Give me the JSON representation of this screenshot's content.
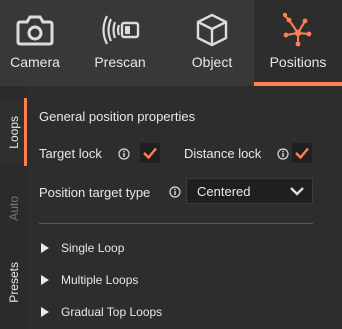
{
  "top_tabs": [
    {
      "label": "Camera",
      "icon": "camera-icon",
      "active": false
    },
    {
      "label": "Prescan",
      "icon": "prescan-icon",
      "active": false
    },
    {
      "label": "Object",
      "icon": "cube-icon",
      "active": false
    },
    {
      "label": "Positions",
      "icon": "positions-network-icon",
      "active": true
    }
  ],
  "side_tabs": [
    {
      "label": "Loops",
      "active": true
    },
    {
      "label": "Auto",
      "active": false
    },
    {
      "label": "Presets",
      "active": false
    }
  ],
  "panel": {
    "title": "General position properties",
    "target_lock": {
      "label": "Target lock",
      "checked": true
    },
    "distance_lock": {
      "label": "Distance lock",
      "checked": true
    },
    "position_target_type": {
      "label": "Position target type",
      "selected": "Centered"
    }
  },
  "loops": [
    {
      "label": "Single Loop"
    },
    {
      "label": "Multiple Loops"
    },
    {
      "label": "Gradual Top Loops"
    }
  ],
  "colors": {
    "accent": "#ff7f50",
    "background": "#2b2b2b",
    "topbar": "#383838"
  }
}
